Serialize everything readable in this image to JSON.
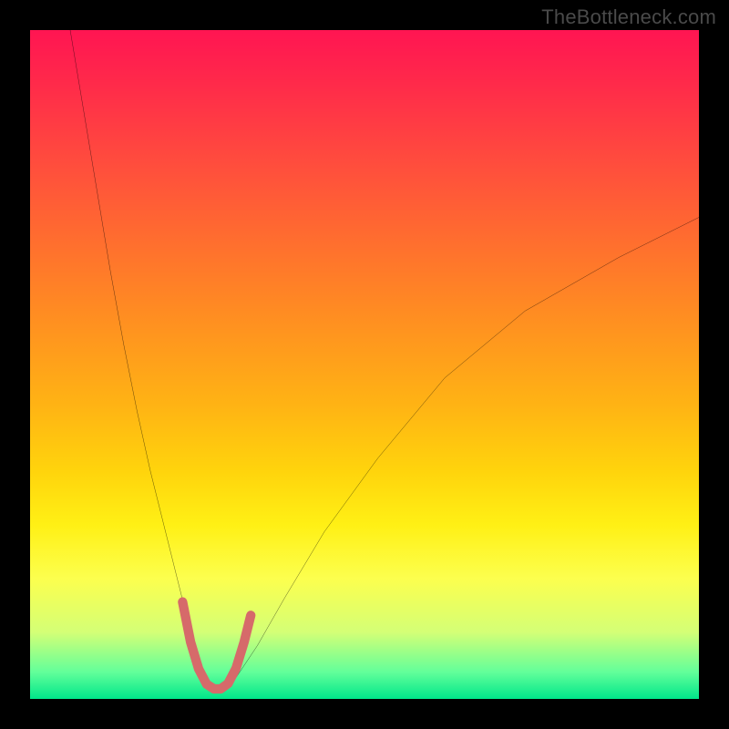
{
  "watermark": "TheBottleneck.com",
  "chart_data": {
    "type": "line",
    "title": "",
    "xlabel": "",
    "ylabel": "",
    "xlim": [
      0,
      100
    ],
    "ylim": [
      0,
      100
    ],
    "grid": false,
    "legend": false,
    "gradient_stops": [
      {
        "pct": 0,
        "color": "#ff1552"
      },
      {
        "pct": 8,
        "color": "#ff2a4a"
      },
      {
        "pct": 20,
        "color": "#ff4d3d"
      },
      {
        "pct": 32,
        "color": "#ff6f2e"
      },
      {
        "pct": 44,
        "color": "#ff9120"
      },
      {
        "pct": 56,
        "color": "#ffb314"
      },
      {
        "pct": 66,
        "color": "#ffd40c"
      },
      {
        "pct": 74,
        "color": "#fff015"
      },
      {
        "pct": 82,
        "color": "#fcff4e"
      },
      {
        "pct": 90,
        "color": "#d4ff76"
      },
      {
        "pct": 96,
        "color": "#62ff9a"
      },
      {
        "pct": 100,
        "color": "#00e68a"
      }
    ],
    "series": [
      {
        "name": "bottleneck-curve",
        "color": "#000000",
        "width": 2,
        "x": [
          6,
          8,
          10,
          12,
          14,
          16,
          18,
          20,
          22,
          24,
          25.5,
          27,
          28.5,
          30,
          34,
          38,
          44,
          52,
          62,
          74,
          88,
          100
        ],
        "y": [
          100,
          88,
          76,
          64,
          53,
          43,
          34,
          26,
          18,
          10,
          5,
          2,
          1,
          2,
          8,
          15,
          25,
          36,
          48,
          58,
          66,
          72
        ]
      },
      {
        "name": "highlight-valley",
        "color": "#d66a6a",
        "width": 10,
        "x": [
          22.8,
          24,
          25.2,
          26.4,
          27.5,
          28.5,
          29.6,
          30.8,
          32,
          33
        ],
        "y": [
          14.5,
          8.5,
          4.5,
          2.2,
          1.5,
          1.5,
          2.3,
          4.6,
          8.5,
          12.5
        ]
      }
    ]
  }
}
